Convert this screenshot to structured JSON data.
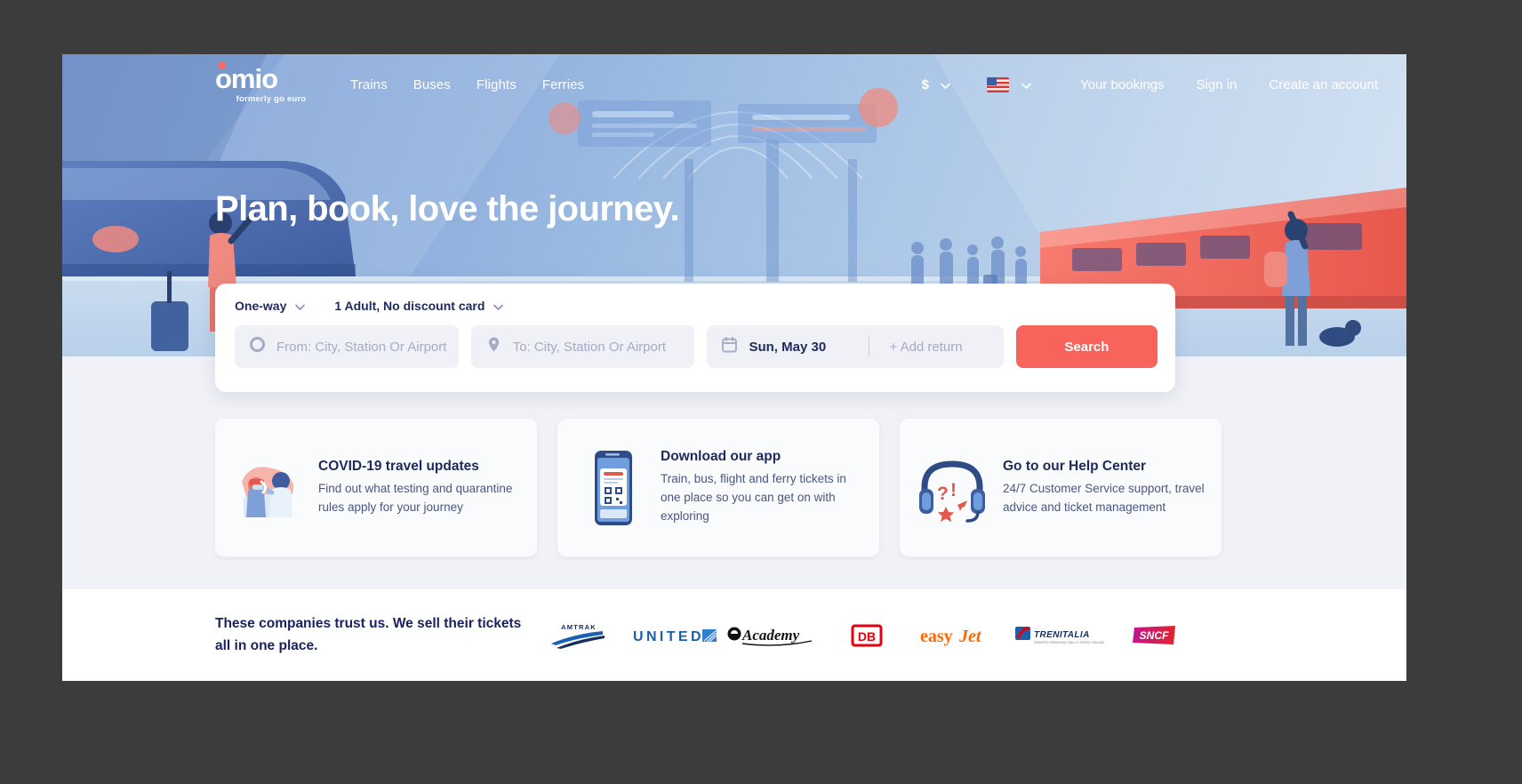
{
  "brand": {
    "logo_text": "omio",
    "logo_sub_prefix": "formerly ",
    "logo_sub_brand": "go euro",
    "accent_color": "#f8635c",
    "navy_color": "#1d2a5c"
  },
  "header": {
    "nav": [
      {
        "label": "Trains"
      },
      {
        "label": "Buses"
      },
      {
        "label": "Flights"
      },
      {
        "label": "Ferries"
      }
    ],
    "currency": "$",
    "language_flag": "us-flag",
    "account_links": [
      {
        "label": "Your bookings"
      },
      {
        "label": "Sign in"
      },
      {
        "label": "Create an account"
      }
    ]
  },
  "hero": {
    "headline": "Plan, book, love the journey."
  },
  "search": {
    "trip_type": "One-way",
    "passengers": "1 Adult, No discount card",
    "from_placeholder": "From: City, Station Or Airport",
    "to_placeholder": "To: City, Station Or Airport",
    "depart_date": "Sun, May 30",
    "add_return": "+ Add return",
    "search_label": "Search"
  },
  "cards": [
    {
      "icon": "covid-test-illustration",
      "title": "COVID-19 travel updates",
      "body": "Find out what testing and quarantine rules apply for your journey"
    },
    {
      "icon": "phone-qr-illustration",
      "title": "Download our app",
      "body": "Train, bus, flight and ferry tickets in one place so you can get on with exploring"
    },
    {
      "icon": "headset-support-illustration",
      "title": "Go to our Help Center",
      "body": "24/7 Customer Service support, travel advice and ticket management"
    }
  ],
  "trust": {
    "heading": "These companies trust us. We sell their tickets all in one place.",
    "logos": [
      {
        "name": "Amtrak"
      },
      {
        "name": "United"
      },
      {
        "name": "Academy"
      },
      {
        "name": "DB"
      },
      {
        "name": "easyJet"
      },
      {
        "name": "Trenitalia"
      },
      {
        "name": "SNCF"
      }
    ]
  }
}
